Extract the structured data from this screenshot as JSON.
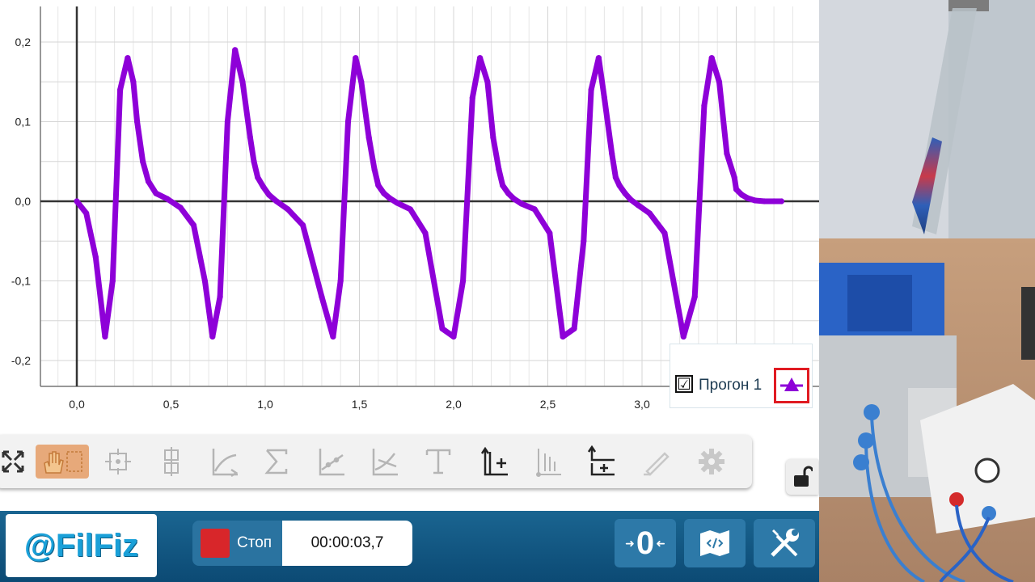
{
  "app": {
    "legend": {
      "checkbox_symbol": "☑",
      "run_label": "Прогон 1",
      "marker_color": "#8e00d8",
      "highlight_color": "#e01b22"
    },
    "bottom": {
      "brand": "@FilFiz",
      "stop_label": "Стоп",
      "timer": "00:00:03,7",
      "zero_label": "0"
    },
    "toolbar": {
      "icons": [
        "fullscreen-icon",
        "hand-select-icon",
        "center-icon",
        "fit-icon",
        "curve-fit-icon",
        "sigma-icon",
        "slope-icon",
        "tangent-icon",
        "text-icon",
        "add-y-axis-icon",
        "add-x-data-icon",
        "add-plot-icon",
        "pen-icon",
        "gear-icon"
      ]
    }
  },
  "chart_data": {
    "type": "line",
    "title": "",
    "xlabel": "",
    "ylabel": "",
    "xlim": [
      -0.2,
      3.9
    ],
    "ylim": [
      -0.23,
      0.245
    ],
    "x_ticks": [
      "0,0",
      "0,5",
      "1,0",
      "1,5",
      "2,0",
      "2,5",
      "3,0"
    ],
    "y_ticks": [
      "0,2",
      "0,1",
      "0,0",
      "-0,1",
      "-0,2"
    ],
    "grid": true,
    "series": [
      {
        "color": "#8e00d8",
        "x": [
          0.0,
          0.05,
          0.1,
          0.15,
          0.19,
          0.23,
          0.27,
          0.3,
          0.32,
          0.35,
          0.38,
          0.42,
          0.48,
          0.55,
          0.62,
          0.68,
          0.72,
          0.76,
          0.8,
          0.84,
          0.88,
          0.92,
          0.94,
          0.96,
          0.99,
          1.02,
          1.06,
          1.12,
          1.2,
          1.3,
          1.36,
          1.4,
          1.44,
          1.48,
          1.51,
          1.55,
          1.58,
          1.6,
          1.63,
          1.66,
          1.7,
          1.77,
          1.85,
          1.94,
          2.0,
          2.05,
          2.1,
          2.14,
          2.18,
          2.21,
          2.24,
          2.26,
          2.29,
          2.32,
          2.36,
          2.43,
          2.51,
          2.58,
          2.64,
          2.69,
          2.73,
          2.77,
          2.8,
          2.84,
          2.86,
          2.88,
          2.91,
          2.94,
          2.98,
          3.04,
          3.12,
          3.22,
          3.28,
          3.33,
          3.37,
          3.41,
          3.45,
          3.49,
          3.5,
          3.53,
          3.56,
          3.6,
          3.65,
          3.7,
          3.74
        ],
        "y": [
          0.0,
          -0.015,
          -0.07,
          -0.17,
          -0.1,
          0.14,
          0.18,
          0.15,
          0.1,
          0.05,
          0.025,
          0.01,
          0.003,
          -0.008,
          -0.03,
          -0.1,
          -0.17,
          -0.12,
          0.1,
          0.19,
          0.15,
          0.08,
          0.05,
          0.03,
          0.018,
          0.008,
          0.0,
          -0.01,
          -0.03,
          -0.12,
          -0.17,
          -0.1,
          0.1,
          0.18,
          0.15,
          0.08,
          0.04,
          0.02,
          0.01,
          0.004,
          -0.002,
          -0.01,
          -0.04,
          -0.16,
          -0.17,
          -0.1,
          0.13,
          0.18,
          0.15,
          0.08,
          0.04,
          0.02,
          0.01,
          0.003,
          -0.003,
          -0.01,
          -0.04,
          -0.17,
          -0.16,
          -0.05,
          0.14,
          0.18,
          0.13,
          0.06,
          0.03,
          0.02,
          0.01,
          0.002,
          -0.005,
          -0.015,
          -0.04,
          -0.17,
          -0.12,
          0.12,
          0.18,
          0.15,
          0.06,
          0.03,
          0.015,
          0.008,
          0.004,
          0.001,
          0.0,
          0.0,
          0.0
        ]
      }
    ]
  }
}
